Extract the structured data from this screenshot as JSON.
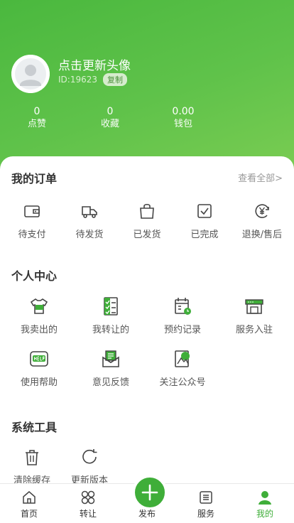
{
  "profile": {
    "nickname": "点击更新头像",
    "id_text": "ID:19623",
    "copy_label": "复制"
  },
  "stats": [
    {
      "value": "0",
      "label": "点赞"
    },
    {
      "value": "0",
      "label": "收藏"
    },
    {
      "value": "0.00",
      "label": "钱包"
    }
  ],
  "orders": {
    "title": "我的订单",
    "view_all": "查看全部>",
    "items": [
      {
        "label": "待支付",
        "icon": "wallet-icon"
      },
      {
        "label": "待发货",
        "icon": "truck-icon"
      },
      {
        "label": "已发货",
        "icon": "shopping-bag-icon"
      },
      {
        "label": "已完成",
        "icon": "checkbox-icon"
      },
      {
        "label": "退换/售后",
        "icon": "yen-refund-icon"
      }
    ]
  },
  "personal": {
    "title": "个人中心",
    "items": [
      {
        "label": "我卖出的",
        "icon": "tshirt-sold-icon"
      },
      {
        "label": "我转让的",
        "icon": "checklist-icon"
      },
      {
        "label": "预约记录",
        "icon": "calendar-clock-icon"
      },
      {
        "label": "服务入驻",
        "icon": "storefront-icon"
      },
      {
        "label": "使用帮助",
        "icon": "help-icon"
      },
      {
        "label": "意见反馈",
        "icon": "feedback-mail-icon"
      },
      {
        "label": "关注公众号",
        "icon": "follow-account-icon"
      }
    ]
  },
  "tools": {
    "title": "系统工具",
    "items": [
      {
        "label": "清除缓存",
        "icon": "trash-icon"
      },
      {
        "label": "更新版本",
        "icon": "refresh-icon"
      }
    ]
  },
  "tabbar": {
    "items": [
      {
        "label": "首页",
        "icon": "home-icon"
      },
      {
        "label": "转让",
        "icon": "grid-circles-icon"
      },
      {
        "label": "发布",
        "icon": "plus-icon"
      },
      {
        "label": "服务",
        "icon": "service-list-icon"
      },
      {
        "label": "我的",
        "icon": "user-icon"
      }
    ],
    "active": "我的"
  },
  "colors": {
    "brand_green": "#3fae39",
    "header_gradient_start": "#4ab83e",
    "header_gradient_end": "#79cc52",
    "icon_stroke": "#444444"
  }
}
